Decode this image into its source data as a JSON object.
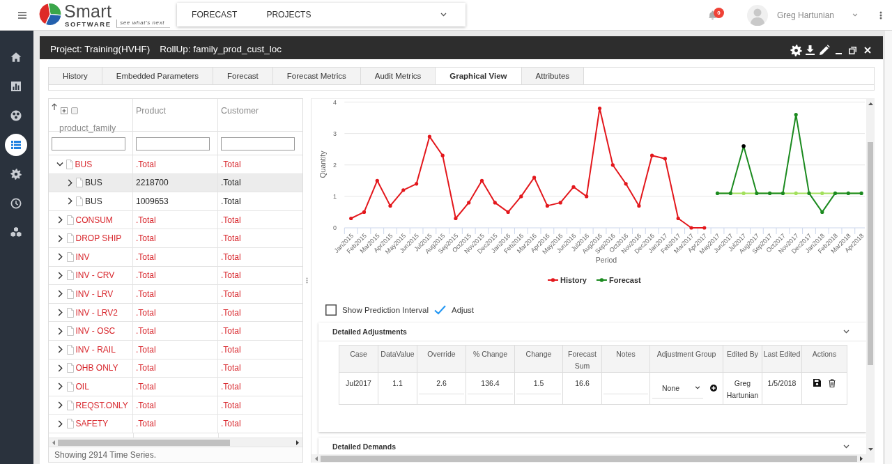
{
  "header": {
    "logo": {
      "wordmark": "Smart",
      "subtitle": "SOFTWARE",
      "slogan": "see what's next"
    },
    "nav": [
      {
        "label": "FORECAST"
      },
      {
        "label": "PROJECTS"
      }
    ],
    "notifications": "0",
    "user": "Greg Hartunian"
  },
  "sidebar": {
    "items": [
      {
        "selected": false
      },
      {
        "selected": false
      },
      {
        "selected": false
      },
      {
        "selected": true
      },
      {
        "selected": false
      },
      {
        "selected": false
      },
      {
        "selected": false
      }
    ]
  },
  "window": {
    "title": "Project: Training(HVHF)",
    "rollup": "RollUp: family_prod_cust_loc"
  },
  "tabs": [
    {
      "label": "History",
      "selected": false
    },
    {
      "label": "Embedded Parameters",
      "selected": false
    },
    {
      "label": "Forecast",
      "selected": false
    },
    {
      "label": "Forecast Metrics",
      "selected": false
    },
    {
      "label": "Audit Metrics",
      "selected": false
    },
    {
      "label": "Graphical View",
      "selected": true
    },
    {
      "label": "Attributes",
      "selected": false
    }
  ],
  "grid": {
    "columns": [
      "product_family",
      "Product",
      "Customer"
    ],
    "select_all": {
      "checked": false
    },
    "rows": [
      {
        "cells": [
          "BUS",
          ".Total",
          ".Total"
        ],
        "expanded": true,
        "selected": false,
        "children": [
          {
            "cells": [
              "BUS",
              "2218700",
              ".Total"
            ],
            "expanded": false,
            "selected": true
          },
          {
            "cells": [
              "BUS",
              "1009653",
              ".Total"
            ],
            "expanded": false,
            "selected": false
          }
        ]
      },
      {
        "cells": [
          "CONSUM",
          ".Total",
          ".Total"
        ],
        "expanded": false,
        "selected": false
      },
      {
        "cells": [
          "DROP SHIP",
          ".Total",
          ".Total"
        ],
        "expanded": false,
        "selected": false
      },
      {
        "cells": [
          "INV",
          ".Total",
          ".Total"
        ],
        "expanded": false,
        "selected": false
      },
      {
        "cells": [
          "INV - CRV",
          ".Total",
          ".Total"
        ],
        "expanded": false,
        "selected": false
      },
      {
        "cells": [
          "INV - LRV",
          ".Total",
          ".Total"
        ],
        "expanded": false,
        "selected": false
      },
      {
        "cells": [
          "INV - LRV2",
          ".Total",
          ".Total"
        ],
        "expanded": false,
        "selected": false
      },
      {
        "cells": [
          "INV - OSC",
          ".Total",
          ".Total"
        ],
        "expanded": false,
        "selected": false
      },
      {
        "cells": [
          "INV - RAIL",
          ".Total",
          ".Total"
        ],
        "expanded": false,
        "selected": false
      },
      {
        "cells": [
          "OHB ONLY",
          ".Total",
          ".Total"
        ],
        "expanded": false,
        "selected": false
      },
      {
        "cells": [
          "OIL",
          ".Total",
          ".Total"
        ],
        "expanded": false,
        "selected": false
      },
      {
        "cells": [
          "REQST.ONLY",
          ".Total",
          ".Total"
        ],
        "expanded": false,
        "selected": false
      },
      {
        "cells": [
          "SAFETY",
          ".Total",
          ".Total"
        ],
        "expanded": false,
        "selected": false
      }
    ],
    "footer": "Showing 2914 Time Series."
  },
  "chart": {
    "chart_data": {
      "type": "line",
      "xlabel": "Period",
      "ylabel": "Quantity",
      "categories": [
        "Jan2015",
        "Feb2015",
        "Mar2015",
        "Apr2015",
        "May2015",
        "Jun2015",
        "Jul2015",
        "Aug2015",
        "Sep2015",
        "Oct2015",
        "Nov2015",
        "Dec2015",
        "Jan2016",
        "Feb2016",
        "Mar2016",
        "Apr2016",
        "May2016",
        "Jun2016",
        "Jul2016",
        "Aug2016",
        "Sep2016",
        "Oct2016",
        "Nov2016",
        "Dec2016",
        "Jan2017",
        "Feb2017",
        "Mar2017",
        "Apr2017",
        "May2017",
        "Jun2017",
        "Jul2017",
        "Aug2017",
        "Sep2017",
        "Oct2017",
        "Nov2017",
        "Dec2017",
        "Jan2018",
        "Feb2018",
        "Mar2018",
        "Apr2018"
      ],
      "series": [
        {
          "name": "History",
          "color": "#e3171c",
          "values": [
            0.3,
            0.5,
            1.5,
            0.7,
            1.2,
            1.4,
            2.9,
            2.3,
            0.3,
            0.8,
            1.5,
            0.8,
            0.5,
            1.0,
            1.6,
            0.7,
            0.8,
            1.3,
            1.0,
            3.8,
            2.0,
            1.4,
            0.7,
            2.3,
            2.2,
            0.3,
            0,
            0,
            null,
            null,
            null,
            null,
            null,
            null,
            null,
            null,
            null,
            null,
            null,
            null
          ]
        },
        {
          "name": "Forecast",
          "color": "#1b8a1f",
          "values": [
            null,
            null,
            null,
            null,
            null,
            null,
            null,
            null,
            null,
            null,
            null,
            null,
            null,
            null,
            null,
            null,
            null,
            null,
            null,
            null,
            null,
            null,
            null,
            null,
            null,
            null,
            null,
            null,
            1.1,
            1.1,
            2.6,
            1.1,
            1.1,
            1.1,
            3.6,
            1.1,
            0.5,
            1.1,
            1.1,
            1.1
          ]
        },
        {
          "color": "#a3e05c",
          "values": [
            null,
            null,
            null,
            null,
            null,
            null,
            null,
            null,
            null,
            null,
            null,
            null,
            null,
            null,
            null,
            null,
            null,
            null,
            null,
            null,
            null,
            null,
            null,
            null,
            null,
            null,
            null,
            null,
            1.1,
            1.1,
            1.1,
            1.1,
            1.1,
            1.1,
            1.1,
            1.1,
            1.1,
            1.1,
            1.1,
            1.1
          ]
        }
      ],
      "ylim": [
        0,
        4
      ],
      "yticks": [
        0,
        1,
        2,
        3,
        4
      ],
      "grid": true,
      "legend": "bottom",
      "annotations": [
        {
          "x": "Jul2017"
        }
      ]
    },
    "options": [
      {
        "label": "Show Prediction Interval",
        "checked": false
      },
      {
        "label": "Adjust",
        "checked": true
      }
    ]
  },
  "adjustments": {
    "title": "Detailed Adjustments",
    "columns": [
      "Case",
      "DataValue",
      "Override",
      "% Change",
      "Change",
      "Forecast Sum",
      "Notes",
      "Adjustment Group",
      "Edited By",
      "Last Edited",
      "Actions"
    ],
    "rows": [
      {
        "case": "Jul2017",
        "data_value": "1.1",
        "override": "2.6",
        "percent_change": "136.4",
        "change": "1.5",
        "forecast_sum": "16.6",
        "adjustment_group": "None",
        "edited_by": "Greg Hartunian",
        "last_edited": "1/5/2018"
      }
    ]
  },
  "demands": {
    "title": "Detailed Demands"
  }
}
